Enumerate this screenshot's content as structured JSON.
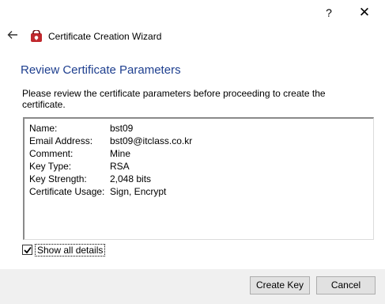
{
  "titlebar": {
    "help_label": "?",
    "close_label": "✕"
  },
  "wizard": {
    "title": "Certificate Creation Wizard",
    "back_icon": "back-arrow-icon",
    "app_icon": "certificate-app-icon"
  },
  "page": {
    "heading": "Review Certificate Parameters",
    "description": "Please review the certificate parameters before proceeding to create the certificate."
  },
  "details": {
    "rows": [
      {
        "label": "Name:",
        "value": "bst09"
      },
      {
        "label": "Email Address:",
        "value": "bst09@itclass.co.kr"
      },
      {
        "label": "Comment:",
        "value": "Mine"
      },
      {
        "label": "Key Type:",
        "value": "RSA"
      },
      {
        "label": "Key Strength:",
        "value": "2,048 bits"
      },
      {
        "label": "Certificate Usage:",
        "value": "Sign, Encrypt"
      }
    ]
  },
  "options": {
    "show_all_label": "Show all details",
    "show_all_checked": true
  },
  "footer": {
    "create_label": "Create Key",
    "cancel_label": "Cancel"
  },
  "colors": {
    "heading": "#1e3f8f",
    "icon_red": "#c0282d",
    "footer_bg": "#f0f0f0"
  }
}
